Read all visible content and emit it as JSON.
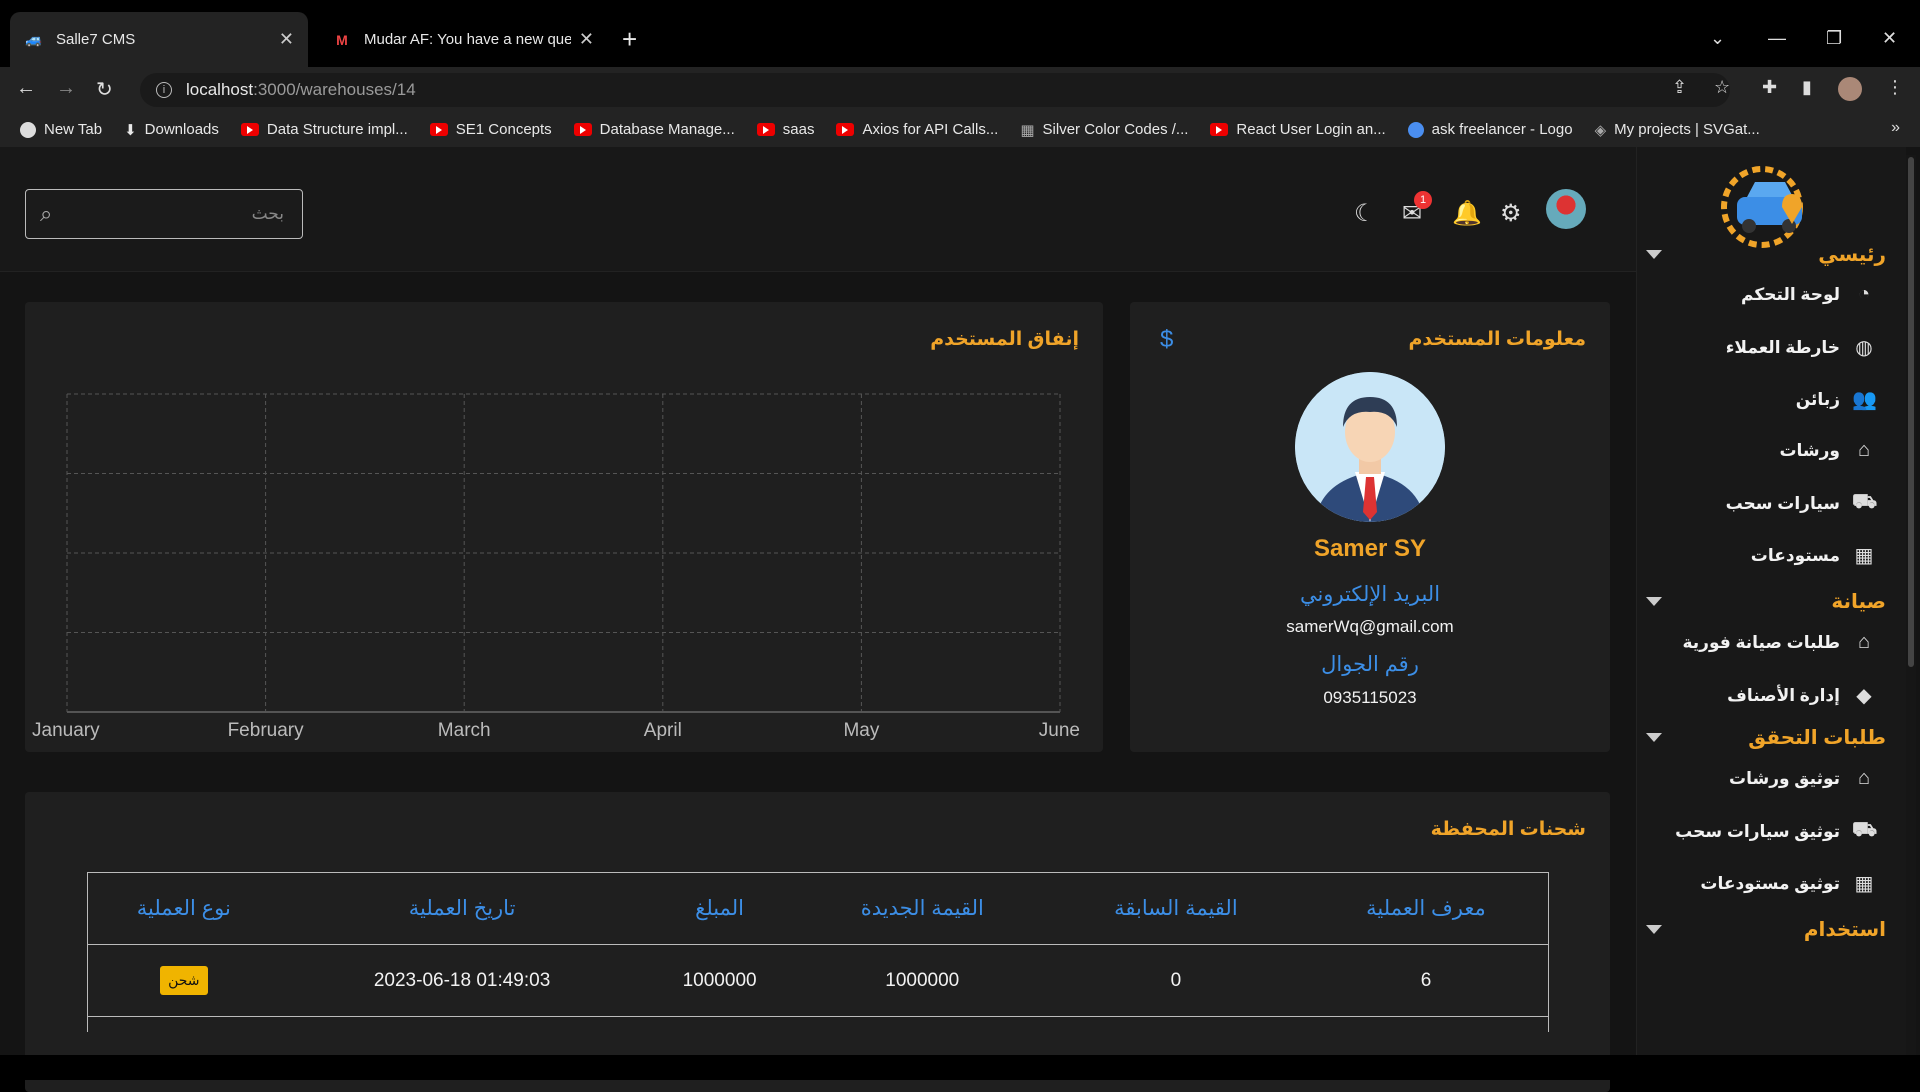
{
  "browser": {
    "tabs": [
      {
        "title": "Salle7 CMS",
        "active": true
      },
      {
        "title": "Mudar AF: You have a new query",
        "active": false
      }
    ],
    "address": {
      "host": "localhost",
      "path": ":3000/warehouses/14"
    },
    "bookmarks": [
      {
        "label": "New Tab",
        "icon": "globe-icon"
      },
      {
        "label": "Downloads",
        "icon": "download-icon"
      },
      {
        "label": "Data Structure impl...",
        "icon": "youtube-icon"
      },
      {
        "label": "SE1 Concepts",
        "icon": "youtube-icon"
      },
      {
        "label": "Database Manage...",
        "icon": "youtube-icon"
      },
      {
        "label": "saas",
        "icon": "youtube-icon"
      },
      {
        "label": "Axios for API Calls...",
        "icon": "youtube-icon"
      },
      {
        "label": "Silver Color Codes /...",
        "icon": "grid-icon"
      },
      {
        "label": "React User Login an...",
        "icon": "youtube-icon"
      },
      {
        "label": "ask freelancer - Logo",
        "icon": "globe-icon"
      },
      {
        "label": "My projects | SVGat...",
        "icon": "svg-icon"
      }
    ]
  },
  "header": {
    "search_placeholder": "بحث",
    "mail_badge": "1"
  },
  "sidebar": {
    "sections": [
      {
        "title": "رئيسي",
        "items": [
          {
            "label": "لوحة التحكم",
            "icon": "pie-chart-icon"
          },
          {
            "label": "خارطة العملاء",
            "icon": "globe-icon"
          },
          {
            "label": "زبائن",
            "icon": "users-icon"
          },
          {
            "label": "ورشات",
            "icon": "home-icon"
          },
          {
            "label": "سيارات سحب",
            "icon": "tow-truck-icon"
          },
          {
            "label": "مستودعات",
            "icon": "warehouse-icon"
          }
        ]
      },
      {
        "title": "صيانة",
        "items": [
          {
            "label": "طلبات صيانة فورية",
            "icon": "home-repair-icon"
          },
          {
            "label": "إدارة الأصناف",
            "icon": "tag-icon"
          }
        ]
      },
      {
        "title": "طلبات التحقق",
        "items": [
          {
            "label": "توثيق ورشات",
            "icon": "home-verify-icon"
          },
          {
            "label": "توثيق سيارات سحب",
            "icon": "tow-truck-icon"
          },
          {
            "label": "توثيق مستودعات",
            "icon": "warehouse-verify-icon"
          }
        ]
      },
      {
        "title": "استخدام",
        "items": []
      }
    ]
  },
  "user_info": {
    "title": "معلومات المستخدم",
    "name": "Samer SY",
    "email_label": "البريد الإلكتروني",
    "email": "samerWq@gmail.com",
    "phone_label": "رقم الجوال",
    "phone": "0935115023",
    "currency_symbol": "$"
  },
  "spending": {
    "title": "إنفاق المستخدم"
  },
  "chart_data": {
    "type": "line",
    "categories": [
      "January",
      "February",
      "March",
      "April",
      "May",
      "June"
    ],
    "series": [],
    "grid": true
  },
  "wallet": {
    "title": "شحنات المحفظة",
    "columns": [
      "معرف العملية",
      "القيمة السابقة",
      "القيمة الجديدة",
      "المبلغ",
      "تاريخ العملية",
      "نوع العملية"
    ],
    "rows": [
      {
        "id": "6",
        "previous": "0",
        "new_value": "1000000",
        "amount": "1000000",
        "date": "2023-06-18 01:49:03",
        "type": "شحن"
      }
    ]
  },
  "colors": {
    "accent": "#f0a429",
    "link": "#3c8ee6",
    "badge": "#f0b400"
  }
}
